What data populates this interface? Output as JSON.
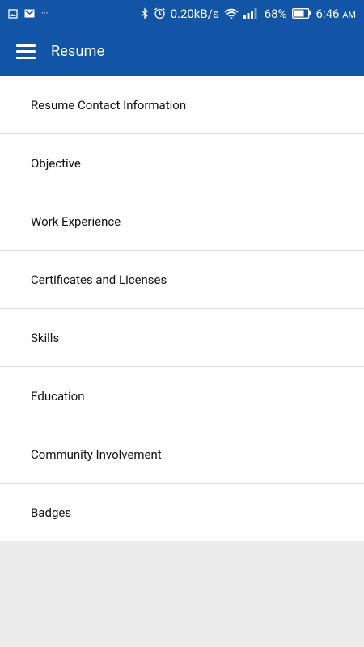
{
  "status_bar": {
    "network_speed": "0.20kB/s",
    "battery": "68%",
    "time": "6:46",
    "ampm": "AM",
    "more": "···"
  },
  "app_bar": {
    "title": "Resume"
  },
  "list": {
    "items": [
      {
        "label": "Resume Contact Information"
      },
      {
        "label": "Objective"
      },
      {
        "label": "Work Experience"
      },
      {
        "label": "Certificates and Licenses"
      },
      {
        "label": "Skills"
      },
      {
        "label": "Education"
      },
      {
        "label": "Community Involvement"
      },
      {
        "label": "Badges"
      }
    ]
  },
  "colors": {
    "primary": "#1254a6",
    "background": "#ececec"
  }
}
